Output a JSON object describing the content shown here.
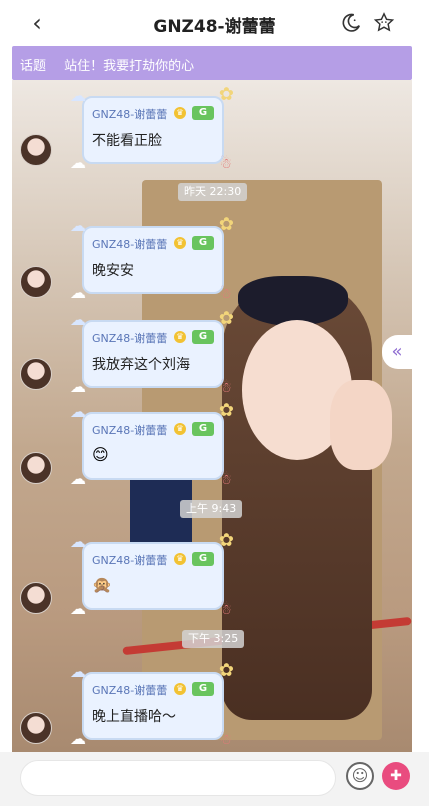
{
  "header": {
    "title": "GNZ48-谢蕾蕾",
    "back_icon": "chevron-left-icon",
    "icons": [
      "moon-icon",
      "star-face-icon"
    ]
  },
  "topic": {
    "label": "话题",
    "text": "站住！我要打劫你的心"
  },
  "messages": [
    {
      "sender": "GNZ48-谢蕾蕾",
      "badge": "G",
      "text": "不能看正脸"
    },
    {
      "sender": "GNZ48-谢蕾蕾",
      "badge": "G",
      "text": "晚安安"
    },
    {
      "sender": "GNZ48-谢蕾蕾",
      "badge": "G",
      "text": "我放弃这个刘海"
    },
    {
      "sender": "GNZ48-谢蕾蕾",
      "badge": "G",
      "emoji": "😊"
    },
    {
      "sender": "GNZ48-谢蕾蕾",
      "badge": "G",
      "emoji": "🙊"
    },
    {
      "sender": "GNZ48-谢蕾蕾",
      "badge": "G",
      "text": "晚上直播哈～"
    }
  ],
  "timestamps": [
    "昨天 22:30",
    "上午 9:43",
    "下午 3:25"
  ],
  "collapse_icon": "double-chevron-left-icon",
  "input": {
    "placeholder": "",
    "emoji_icon": "smiley-icon",
    "gift_icon": "gift-icon"
  },
  "colors": {
    "topic_bg": "#b59ee6",
    "bubble_bg": "#eaf2ff",
    "bubble_border": "#c8daf2",
    "badge_green": "#69c45e",
    "gift_pink": "#e94c7f"
  }
}
